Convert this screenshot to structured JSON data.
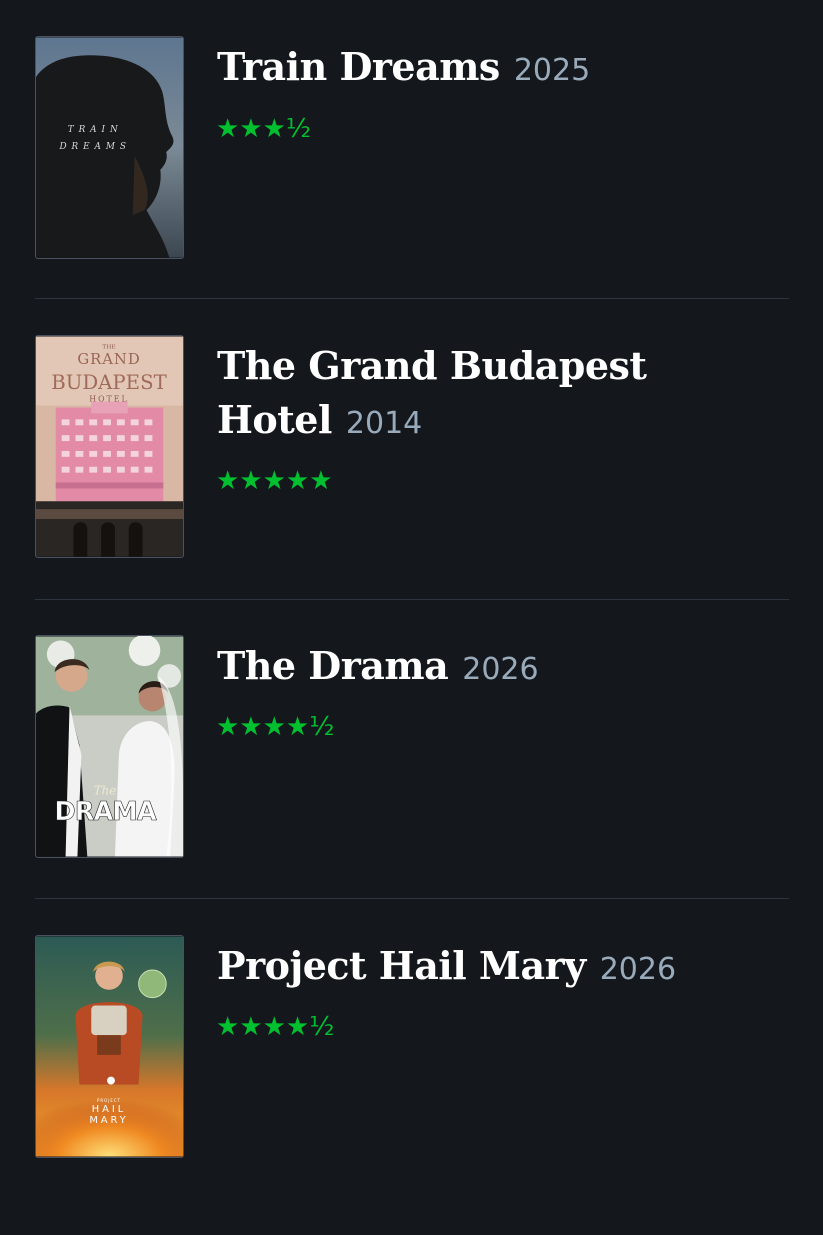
{
  "films": [
    {
      "title": "Train Dreams",
      "year": "2025",
      "rating": "★★★½",
      "poster_text": [
        "TRAIN",
        "DREAMS"
      ]
    },
    {
      "title": "The Grand Budapest Hotel",
      "year": "2014",
      "rating": "★★★★★",
      "poster_text": [
        "THE",
        "GRAND",
        "BUDAPEST",
        "HOTEL"
      ]
    },
    {
      "title": "The Drama",
      "year": "2026",
      "rating": "★★★★½",
      "poster_text": [
        "The",
        "DRAMA"
      ]
    },
    {
      "title": "Project Hail Mary",
      "year": "2026",
      "rating": "★★★★½",
      "poster_text": [
        "PROJECT",
        "HAIL",
        "MARY"
      ]
    }
  ],
  "colors": {
    "background": "#14181d",
    "rating_green": "#00c030",
    "year_gray": "#99aabb",
    "divider": "#2c3440"
  }
}
